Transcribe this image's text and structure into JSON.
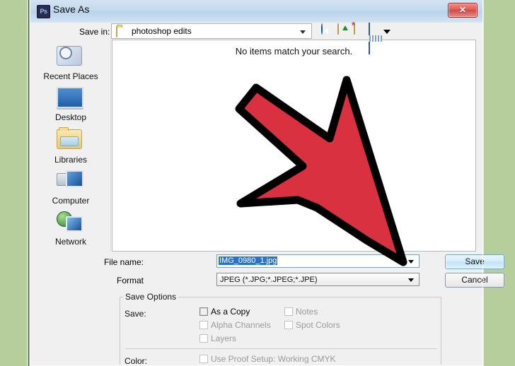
{
  "window": {
    "title": "Save As",
    "app_icon": "photoshop-ps-icon",
    "app_icon_text": "Ps",
    "close_label": "✕"
  },
  "toolbar": {
    "save_in_label": "Save in:",
    "current_folder": "photoshop edits",
    "icons": [
      {
        "name": "back-icon",
        "label": "Back"
      },
      {
        "name": "up-folder-icon",
        "label": "Up One Level"
      },
      {
        "name": "new-folder-icon",
        "label": "Create New Folder"
      },
      {
        "name": "views-icon",
        "label": "Views"
      }
    ]
  },
  "places": [
    {
      "label": "Recent Places",
      "icon": "recent-places-icon"
    },
    {
      "label": "Desktop",
      "icon": "desktop-icon"
    },
    {
      "label": "Libraries",
      "icon": "libraries-icon"
    },
    {
      "label": "Computer",
      "icon": "computer-icon"
    },
    {
      "label": "Network",
      "icon": "network-icon"
    }
  ],
  "file_list": {
    "empty_message": "No items match your search.",
    "items": []
  },
  "fields": {
    "file_name_label": "File name:",
    "file_name_value": "IMG_0980_1.jpg",
    "format_label": "Format",
    "format_value": "JPEG (*.JPG;*.JPEG;*.JPE)"
  },
  "buttons": {
    "save": "Save",
    "cancel": "Cancel"
  },
  "save_options": {
    "group_title": "Save Options",
    "save_row_label": "Save:",
    "color_row_label": "Color:",
    "checkboxes": [
      {
        "label": "As a Copy",
        "checked": false,
        "enabled": true,
        "focused": true
      },
      {
        "label": "Alpha Channels",
        "checked": false,
        "enabled": false,
        "focused": false
      },
      {
        "label": "Layers",
        "checked": false,
        "enabled": false,
        "focused": false
      },
      {
        "label": "Notes",
        "checked": false,
        "enabled": false,
        "focused": false
      },
      {
        "label": "Spot Colors",
        "checked": false,
        "enabled": false,
        "focused": false
      },
      {
        "label": "Use Proof Setup:  Working CMYK",
        "checked": false,
        "enabled": false,
        "focused": false
      }
    ]
  },
  "annotation": {
    "name": "red-arrow-pointer",
    "points_to": "Save",
    "fill_color": "#d9313f",
    "stroke_color": "#000000"
  },
  "colors": {
    "desktop_background": "#b6ce9c",
    "dialog_background": "#f0f0f0",
    "title_bar": "#c3d9ee",
    "selection_blue": "#2a72c8",
    "accent_red": "#d9313f"
  }
}
